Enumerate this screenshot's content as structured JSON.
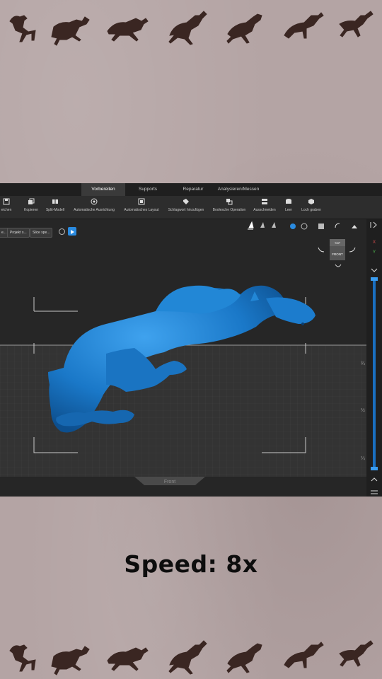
{
  "app": {
    "tabs": [
      {
        "label": "Vorbereiten",
        "active": true
      },
      {
        "label": "Supports",
        "active": false
      },
      {
        "label": "Reparatur",
        "active": false
      },
      {
        "label": "Analysieren/Messen",
        "active": false
      }
    ],
    "toolbar": [
      {
        "label": "eichen",
        "icon": "save-icon"
      },
      {
        "label": "Kopieren",
        "icon": "copy-icon"
      },
      {
        "label": "Split-Modell",
        "icon": "split-icon"
      },
      {
        "label": "Automatische Ausrichtung",
        "icon": "orient-icon"
      },
      {
        "label": "Automatisches Layout",
        "icon": "layout-icon"
      },
      {
        "label": "Schlagwort hinzufügen",
        "icon": "tag-icon"
      },
      {
        "label": "Boolesche Operation",
        "icon": "boolean-icon"
      },
      {
        "label": "Ausschneiden",
        "icon": "cut-icon"
      },
      {
        "label": "Leer",
        "icon": "hollow-icon"
      },
      {
        "label": "Loch graben",
        "icon": "hole-icon"
      }
    ],
    "breadcrumbs": [
      "e...",
      "Projekt s...",
      "Slice spe..."
    ],
    "viewcube": {
      "top": "TOP",
      "front": "FRONT"
    },
    "view_label": "Front",
    "side_ticks": [
      "¾",
      "½",
      "¼"
    ],
    "colors": {
      "model": "#1d7fd0",
      "accent": "#2a8be0",
      "grid": "#3b3b3b"
    }
  },
  "caption": "Speed: 8x"
}
